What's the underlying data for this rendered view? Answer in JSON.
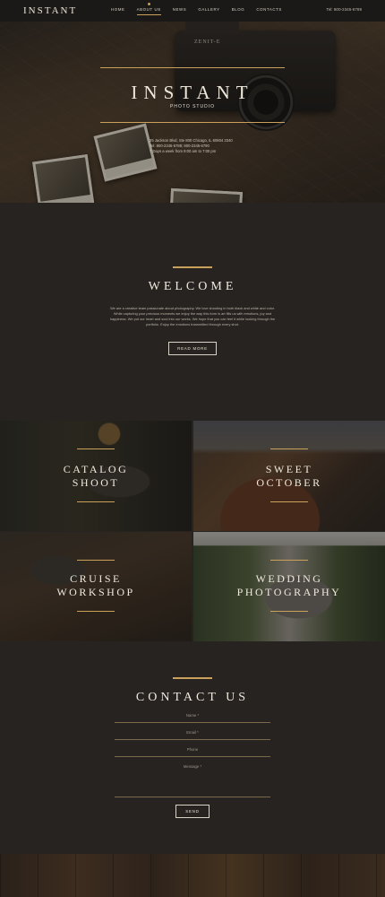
{
  "nav": {
    "logo": "INSTANT",
    "items": [
      {
        "label": "Home",
        "active": false
      },
      {
        "label": "About us",
        "active": true
      },
      {
        "label": "News",
        "active": false
      },
      {
        "label": "Gallery",
        "active": false
      },
      {
        "label": "Blog",
        "active": false
      },
      {
        "label": "Contacts",
        "active": false
      }
    ],
    "phone": "Tel: 800-2345-6789"
  },
  "hero": {
    "title": "INSTANT",
    "subtitle": "PHOTO STUDIO",
    "camera_brand": "ZENIT-E",
    "info": [
      "25 Jackson Blvd, Ste 800 Chicago, IL 60604 3340",
      "Tel: 800-2345-6789; 800-2345-6790",
      "7 Days a week from 9:00 am to 7:00 pm"
    ]
  },
  "welcome": {
    "title": "WELCOME",
    "text": "We are a creative team passionate about photography. We love shooting in both black and white and color. While capturing your precious moments we enjoy the way this form is art fills us with emotions, joy and happiness. We put our heart and soul into our works. We hope that you can feel it while looking through the portfolio. Enjoy the emotions transmitted through every shot.",
    "button": "Read more"
  },
  "gallery": [
    {
      "line1": "CATALOG",
      "line2": "SHOOT"
    },
    {
      "line1": "SWEET",
      "line2": "OCTOBER"
    },
    {
      "line1": "CRUISE",
      "line2": "WORKSHOP"
    },
    {
      "line1": "WEDDING",
      "line2": "PHOTOGRAPHY"
    }
  ],
  "contact": {
    "title": "CONTACT US",
    "name_placeholder": "Name *",
    "email_placeholder": "Email *",
    "phone_placeholder": "Phone",
    "message_placeholder": "Message *",
    "button": "Send"
  },
  "colors": {
    "accent": "#c9a15a",
    "background": "#262320",
    "nav": "#1b1917"
  }
}
